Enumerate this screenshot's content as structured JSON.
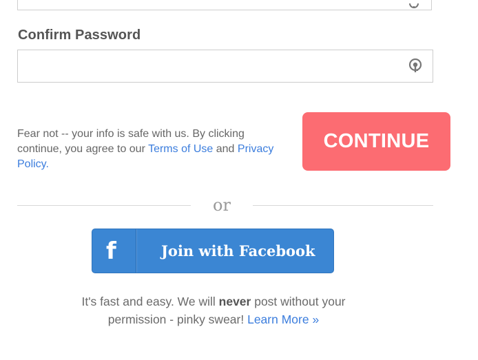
{
  "password_field": {
    "label": "Confirm Password",
    "value": "",
    "placeholder": "",
    "icon": "key-icon"
  },
  "previous_field": {
    "icon": "key-icon"
  },
  "disclaimer": {
    "prefix": "Fear not -- your info is safe with us. By clicking continue, you agree to our ",
    "terms_link": "Terms of Use",
    "middle": " and ",
    "privacy_link": "Privacy Policy",
    "suffix": "."
  },
  "continue_button": {
    "label": "CONTINUE",
    "color": "#fc6c72"
  },
  "divider": {
    "label": "or"
  },
  "facebook_button": {
    "icon_glyph": "f",
    "label": "Join with Facebook",
    "color": "#3b86d3"
  },
  "fast_note": {
    "part1": "It's fast and easy. We will ",
    "emphasis": "never",
    "part2": " post without your permission - pinky swear! ",
    "learn_more": "Learn More »"
  },
  "colors": {
    "link": "#3b7ddd"
  }
}
